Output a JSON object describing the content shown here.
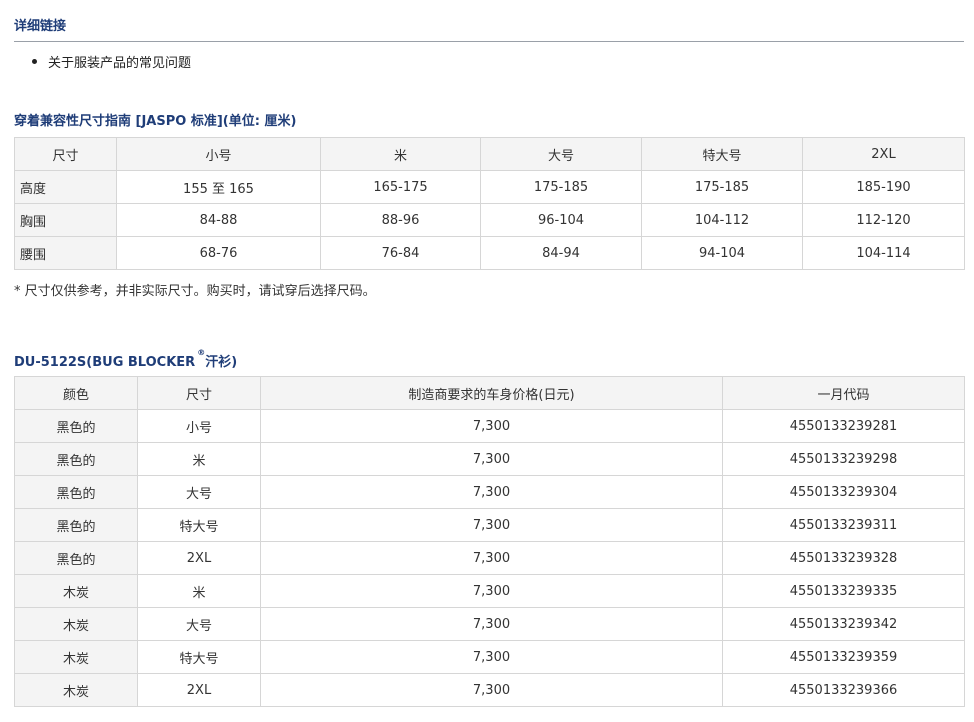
{
  "links": {
    "title": "详细链接",
    "items": [
      "关于服装产品的常见问题"
    ]
  },
  "size_guide": {
    "title": "穿着兼容性尺寸指南 [JASPO 标准](单位: 厘米)",
    "headers": [
      "尺寸",
      "小号",
      "米",
      "大号",
      "特大号",
      "2XL"
    ],
    "rows": [
      {
        "label": "高度",
        "values": [
          "155 至 165",
          "165-175",
          "175-185",
          "175-185",
          "185-190"
        ]
      },
      {
        "label": "胸围",
        "values": [
          "84-88",
          "88-96",
          "96-104",
          "104-112",
          "112-120"
        ]
      },
      {
        "label": "腰围",
        "values": [
          "68-76",
          "76-84",
          "84-94",
          "94-104",
          "104-114"
        ]
      }
    ],
    "note": "* 尺寸仅供参考，并非实际尺寸。购买时，请试穿后选择尺码。"
  },
  "product": {
    "title_prefix": "DU-5122S(BUG BLOCKER",
    "registered_mark": "®",
    "title_suffix": "汗衫)",
    "headers": [
      "颜色",
      "尺寸",
      "制造商要求的车身价格(日元)",
      "一月代码"
    ],
    "rows": [
      {
        "color": "黑色的",
        "size": "小号",
        "price": "7,300",
        "code": "4550133239281"
      },
      {
        "color": "黑色的",
        "size": "米",
        "price": "7,300",
        "code": "4550133239298"
      },
      {
        "color": "黑色的",
        "size": "大号",
        "price": "7,300",
        "code": "4550133239304"
      },
      {
        "color": "黑色的",
        "size": "特大号",
        "price": "7,300",
        "code": "4550133239311"
      },
      {
        "color": "黑色的",
        "size": "2XL",
        "price": "7,300",
        "code": "4550133239328"
      },
      {
        "color": "木炭",
        "size": "米",
        "price": "7,300",
        "code": "4550133239335"
      },
      {
        "color": "木炭",
        "size": "大号",
        "price": "7,300",
        "code": "4550133239342"
      },
      {
        "color": "木炭",
        "size": "特大号",
        "price": "7,300",
        "code": "4550133239359"
      },
      {
        "color": "木炭",
        "size": "2XL",
        "price": "7,300",
        "code": "4550133239366"
      }
    ]
  },
  "colors": {
    "title": "#1f3d78",
    "header_bg": "#f4f4f4",
    "border": "#d6d6d6"
  }
}
